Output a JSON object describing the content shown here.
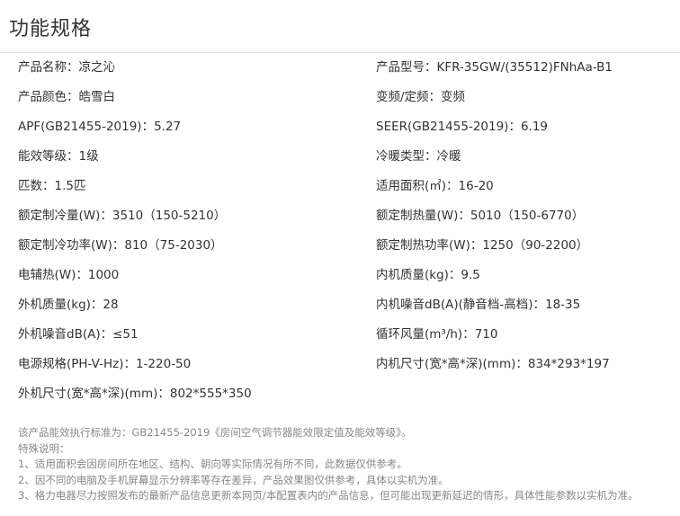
{
  "page": {
    "title": "功能规格"
  },
  "specs": [
    "产品名称：凉之沁",
    "产品型号：KFR-35GW/(35512)FNhAa-B1",
    "产品颜色：皓雪白",
    "变频/定频：变频",
    "APF(GB21455-2019)：5.27",
    "SEER(GB21455-2019)：6.19",
    "能效等级：1级",
    "冷暖类型：冷暖",
    "匹数：1.5匹",
    "适用面积(㎡)：16-20",
    "额定制冷量(W)：3510（150-5210）",
    "额定制热量(W)：5010（150-6770）",
    "额定制冷功率(W)：810（75-2030）",
    "额定制热功率(W)：1250（90-2200）",
    "电辅热(W)：1000",
    "内机质量(kg)：9.5",
    "外机质量(kg)：28",
    "内机噪音dB(A)(静音档-高档)：18-35",
    "外机噪音dB(A)：≤51",
    "循环风量(m³/h)：710",
    "电源规格(PH-V-Hz)：1-220-50",
    "内机尺寸(宽*高*深)(mm)：834*293*197",
    "外机尺寸(宽*高*深)(mm)：802*555*350"
  ],
  "notes": [
    "该产品能效执行标准为：GB21455-2019《房间空气调节器能效限定值及能效等级》。",
    "特殊说明：",
    "1、适用面积会因房间所在地区、结构、朝向等实际情况有所不同，此数据仅供参考。",
    "2、因不同的电脑及手机屏幕显示分辨率等存在差异，产品效果图仅供参考，具体以实机为准。",
    "3、格力电器尽力按照发布的最新产品信息更新本网页/本配置表内的产品信息，但可能出现更新延迟的情形，具体性能参数以实机为准。"
  ]
}
